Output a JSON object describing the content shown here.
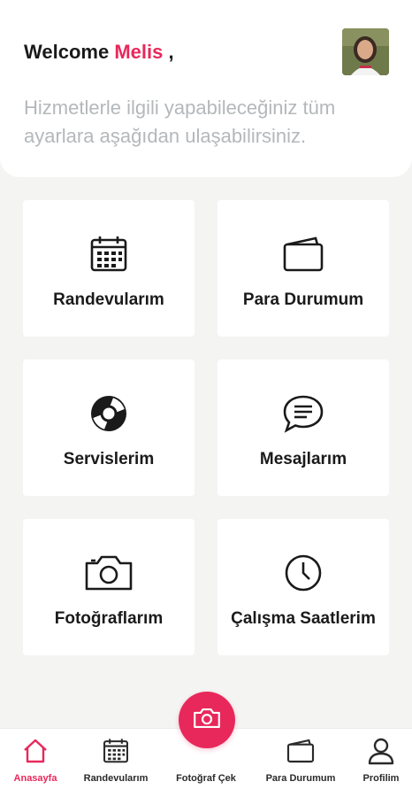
{
  "header": {
    "welcome_prefix": "Welcome",
    "user_name": "Melis",
    "welcome_suffix": ",",
    "subtitle": "Hizmetlerle ilgili yapabileceğiniz tüm ayarlara aşağıdan ulaşabilirsiniz."
  },
  "menu": {
    "items": [
      {
        "label": "Randevularım",
        "icon": "calendar-icon"
      },
      {
        "label": "Para Durumum",
        "icon": "wallet-icon"
      },
      {
        "label": "Servislerim",
        "icon": "lifebuoy-icon"
      },
      {
        "label": "Mesajlarım",
        "icon": "chat-bubble-icon"
      },
      {
        "label": "Fotoğraflarım",
        "icon": "camera-icon"
      },
      {
        "label": "Çalışma Saatlerim",
        "icon": "clock-icon"
      }
    ]
  },
  "bottom_nav": {
    "items": [
      {
        "label": "Anasayfa",
        "icon": "home-icon",
        "active": true
      },
      {
        "label": "Randevularım",
        "icon": "calendar-icon",
        "active": false
      },
      {
        "label": "Fotoğraf Çek",
        "icon": "camera-icon",
        "active": false
      },
      {
        "label": "Para Durumum",
        "icon": "wallet-icon",
        "active": false
      },
      {
        "label": "Profilim",
        "icon": "user-icon",
        "active": false
      }
    ]
  },
  "colors": {
    "accent": "#e8285a",
    "background": "#f4f5f3",
    "card": "#ffffff",
    "text": "#1a1a1a",
    "muted": "#b4b8bb"
  }
}
